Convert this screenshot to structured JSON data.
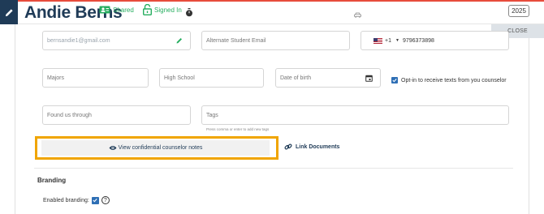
{
  "header": {
    "name": "Andie Berns",
    "shared_label": "Shared",
    "signed_in_label": "Signed In",
    "year": "2025",
    "close_label": "CLOSE"
  },
  "form": {
    "email_value": "bernsandie1@gmail.com",
    "alt_email_placeholder": "Alternate Student Email",
    "phone_code": "+1",
    "phone_value": "9796373898",
    "majors_placeholder": "Majors",
    "high_school_placeholder": "High School",
    "dob_placeholder": "Date of birth",
    "optin_label": "Opt-in to receive texts from you counselor",
    "optin_checked": true,
    "found_placeholder": "Found us through",
    "tags_placeholder": "Tags",
    "tags_help": "Press comma or enter to add new tags"
  },
  "actions": {
    "view_notes_label": "View confidential counselor notes",
    "link_documents_label": "Link Documents"
  },
  "branding": {
    "heading": "Branding",
    "enabled_label": "Enabled branding:",
    "enabled_checked": true,
    "help_glyph": "?"
  },
  "colors": {
    "brand": "#1f3b57",
    "success": "#27ae60",
    "highlight": "#f0a500",
    "checkbox": "#2e6fb5"
  }
}
